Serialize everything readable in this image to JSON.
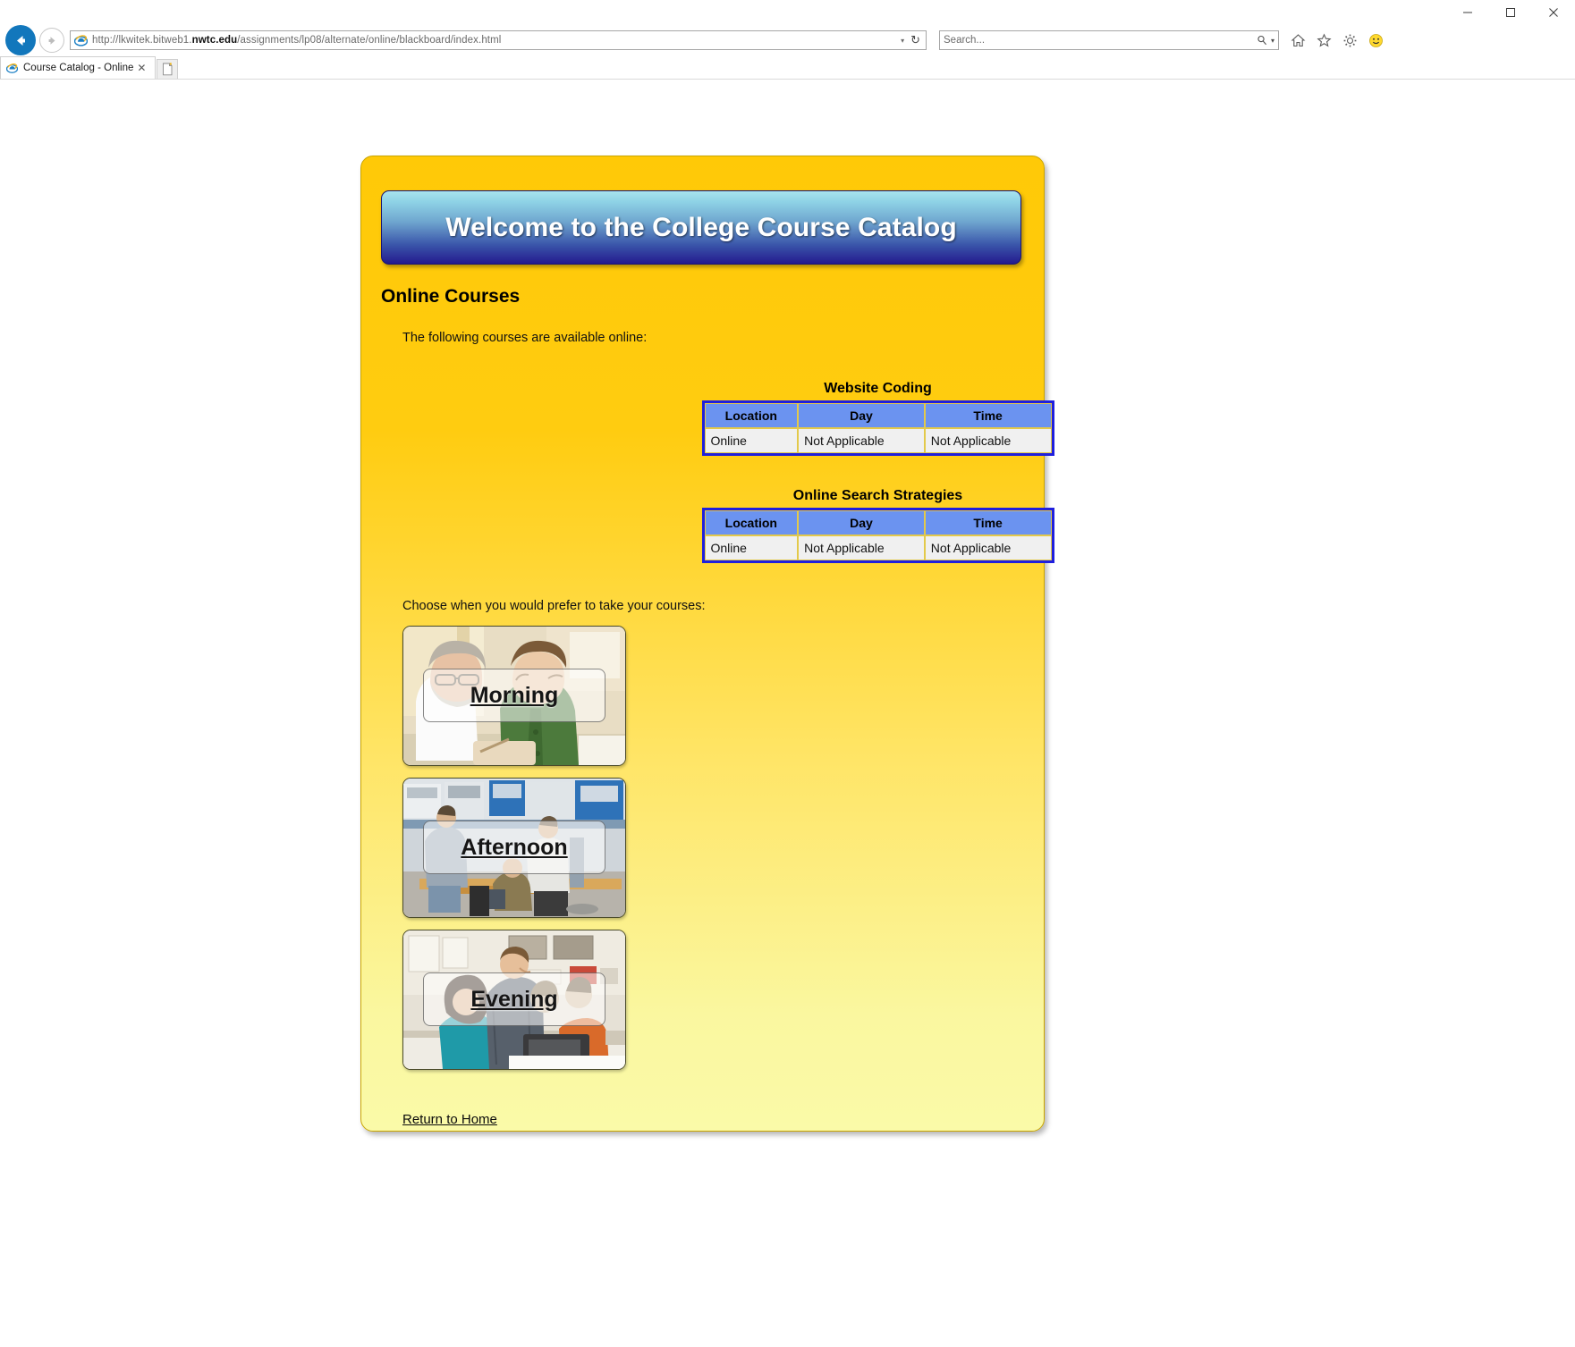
{
  "browser": {
    "window_controls": {
      "minimize": "–",
      "maximize": "□",
      "close": "✕"
    },
    "back_label": "Back",
    "forward_label": "Forward",
    "url_prefix": "http://lkwitek.bitweb1.",
    "url_bold": "nwtc.edu",
    "url_suffix": "/assignments/lp08/alternate/online/blackboard/index.html",
    "url_full": "http://lkwitek.bitweb1.nwtc.edu/assignments/lp08/alternate/online/blackboard/index.html",
    "address_dropdown": "▾",
    "refresh_glyph": "↻",
    "search_placeholder": "Search...",
    "search_glyph": "⌕",
    "search_dropdown": "▾",
    "icons": [
      "home-icon",
      "favorites-star-icon",
      "gear-icon",
      "smiley-icon"
    ],
    "tab": {
      "title": "Course Catalog - Online",
      "close": "✕",
      "new_tab_label": "New tab"
    }
  },
  "page": {
    "banner_title": "Welcome to the College Course Catalog",
    "heading": "Online Courses",
    "intro": "The following courses are available online:",
    "tables": [
      {
        "caption": "Website Coding",
        "headers": [
          "Location",
          "Day",
          "Time"
        ],
        "rows": [
          [
            "Online",
            "Not Applicable",
            "Not Applicable"
          ]
        ]
      },
      {
        "caption": "Online Search Strategies",
        "headers": [
          "Location",
          "Day",
          "Time"
        ],
        "rows": [
          [
            "Online",
            "Not Applicable",
            "Not Applicable"
          ]
        ]
      }
    ],
    "chooser_prompt": "Choose when you would prefer to take your courses:",
    "time_buttons": [
      {
        "label": "Morning",
        "image_alt": "two-men-at-desk-photo"
      },
      {
        "label": "Afternoon",
        "image_alt": "electronics-lab-photo"
      },
      {
        "label": "Evening",
        "image_alt": "computer-classroom-photo"
      }
    ],
    "return_link": "Return to Home"
  },
  "colors": {
    "page_top": "#FFC907",
    "page_bottom": "#FAFAA8",
    "banner_top": "#A8E3EE",
    "banner_bottom": "#241A8E",
    "table_header": "#6B93F0",
    "table_border": "#1F1FDD",
    "table_cell_border": "#E3C94A",
    "ie_blue": "#1277BC"
  }
}
